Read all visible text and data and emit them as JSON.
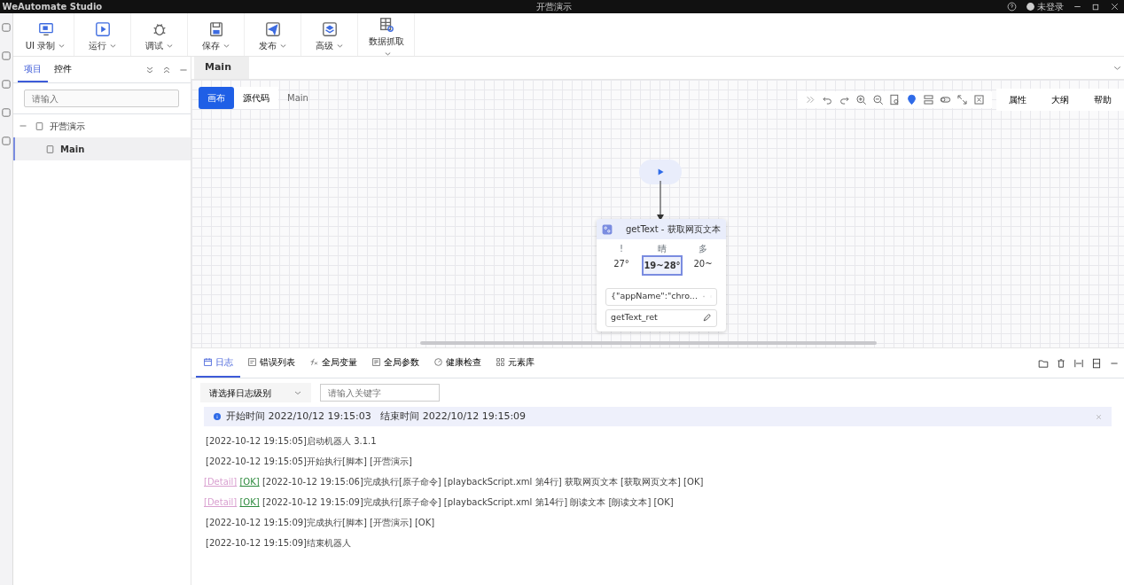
{
  "window": {
    "app_name": "WeAutomate Studio",
    "title": "开营演示",
    "user": "未登录"
  },
  "toolbar": [
    {
      "label": "UI 录制"
    },
    {
      "label": "运行"
    },
    {
      "label": "调试"
    },
    {
      "label": "保存"
    },
    {
      "label": "发布"
    },
    {
      "label": "高级"
    },
    {
      "label": "数据抓取"
    }
  ],
  "left_panel": {
    "tabs": [
      {
        "label": "项目",
        "selected": true
      },
      {
        "label": "控件",
        "selected": false
      }
    ],
    "search": {
      "placeholder": "请输入"
    },
    "tree": [
      {
        "label": "开营演示",
        "expanded": true,
        "selected": false,
        "children": [
          {
            "label": "Main",
            "selected": true
          }
        ]
      }
    ]
  },
  "editor": {
    "tab": "Main",
    "view_tabs": [
      {
        "label": "画布",
        "selected": true
      },
      {
        "label": "源代码",
        "selected": false
      },
      {
        "label": "Main",
        "selected": false
      }
    ],
    "side_buttons": [
      "属性",
      "大纲",
      "帮助"
    ],
    "node": {
      "title": "getText - 获取网页文本",
      "preview": [
        {
          "label": "!",
          "temp": "27°",
          "selected": false
        },
        {
          "label": "晴",
          "temp": "19~28°",
          "selected": true
        },
        {
          "label": "多",
          "temp": "20~",
          "selected": false
        }
      ],
      "target": "{\"appName\":\"chro...",
      "output": "getText_ret"
    }
  },
  "bottom_panel": {
    "tabs": [
      {
        "label": "日志",
        "selected": true
      },
      {
        "label": "错误列表",
        "selected": false
      },
      {
        "label": "全局变量",
        "selected": false
      },
      {
        "label": "全局参数",
        "selected": false
      },
      {
        "label": "健康检查",
        "selected": false
      },
      {
        "label": "元素库",
        "selected": false
      }
    ],
    "level_select": {
      "placeholder": "请选择日志级别"
    },
    "keyword": {
      "placeholder": "请输入关键字"
    },
    "info": "开始时间 2022/10/12 19:15:03   结束时间 2022/10/12 19:15:09",
    "log": [
      {
        "text": "[2022-10-12 19:15:05]启动机器人 3.1.1"
      },
      {
        "text": "[2022-10-12 19:15:05]开始执行[脚本] [开营演示]"
      },
      {
        "links": [
          "[Detail]",
          "[OK]"
        ],
        "text": "[2022-10-12 19:15:06]完成执行[原子命令] [playbackScript.xml 第4行] 获取网页文本 [获取网页文本] [OK]"
      },
      {
        "links": [
          "[Detail]",
          "[OK]"
        ],
        "text": "[2022-10-12 19:15:09]完成执行[原子命令] [playbackScript.xml 第14行] 朗读文本 [朗读文本] [OK]"
      },
      {
        "text": "[2022-10-12 19:15:09]完成执行[脚本] [开营演示] [OK]"
      },
      {
        "text": "[2022-10-12 19:15:09]结束机器人"
      }
    ]
  }
}
